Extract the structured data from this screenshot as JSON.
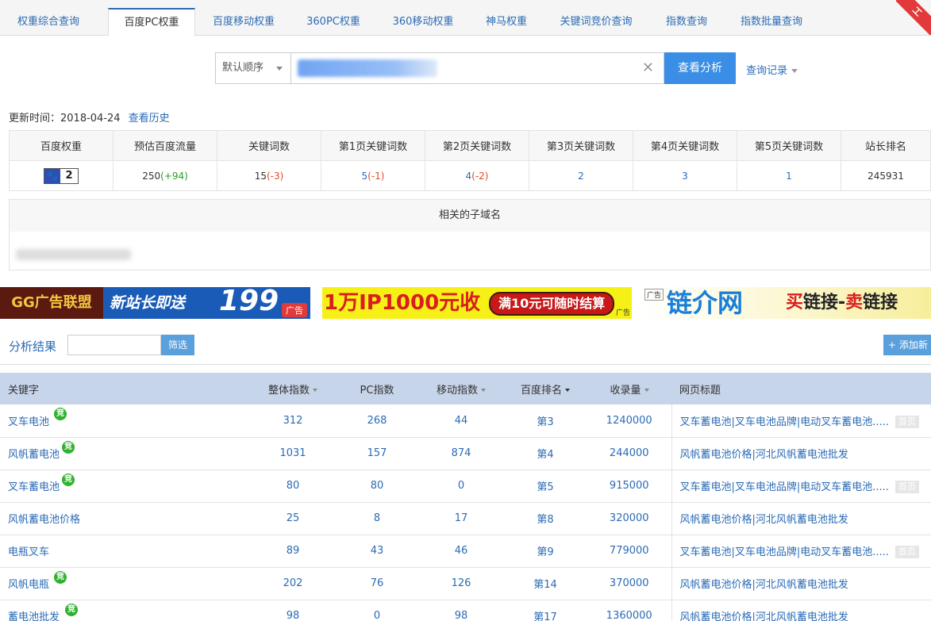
{
  "tabs": [
    {
      "label": "权重综合查询",
      "active": false
    },
    {
      "label": "百度PC权重",
      "active": true
    },
    {
      "label": "百度移动权重",
      "active": false
    },
    {
      "label": "360PC权重",
      "active": false
    },
    {
      "label": "360移动权重",
      "active": false
    },
    {
      "label": "神马权重",
      "active": false
    },
    {
      "label": "关键词竞价查询",
      "active": false
    },
    {
      "label": "指数查询",
      "active": false
    },
    {
      "label": "指数批量查询",
      "active": false
    }
  ],
  "search": {
    "order_label": "默认顺序",
    "clear_glyph": "✕",
    "analyze_label": "查看分析",
    "history_label": "查询记录"
  },
  "update": {
    "label": "更新时间：2018-04-24",
    "history_link": "查看历史"
  },
  "weight_table": {
    "headers": [
      "百度权重",
      "预估百度流量",
      "关键词数",
      "第1页关键词数",
      "第2页关键词数",
      "第3页关键词数",
      "第4页关键词数",
      "第5页关键词数",
      "站长排名"
    ],
    "weight_value": "2",
    "paw_glyph": "🐾",
    "traffic": "250",
    "traffic_delta": "(+94)",
    "keywords": "15",
    "keywords_delta": "(-3)",
    "page1": "5",
    "page1_delta": "(-1)",
    "page2": "4",
    "page2_delta": "(-2)",
    "page3": "2",
    "page4": "3",
    "page5": "1",
    "rank": "245931"
  },
  "subdomain": {
    "title": "相关的子域名"
  },
  "banners": {
    "b1_left": "GG广告联盟",
    "b1_mid": "新站长即送",
    "b1_num": "199",
    "b1_tag": "广告",
    "b2_big": "1万IP1000元收",
    "b2_pill": "满10元可随时结算",
    "b2_ad": "广告",
    "b3_ad": "广告",
    "b3_logo": "链介网",
    "b3_buy": "买",
    "b3_link1": "链接-",
    "b3_sell": "卖",
    "b3_link2": "链接"
  },
  "results": {
    "title": "分析结果",
    "filter_label": "筛选",
    "add_label": "+ 添加新",
    "columns": [
      "关键字",
      "整体指数",
      "PC指数",
      "移动指数",
      "百度排名",
      "收录量",
      "网页标题"
    ],
    "jing_glyph": "竞",
    "home_badge": "首页",
    "rows": [
      {
        "keyword": "叉车电池",
        "jing": true,
        "total": "312",
        "pc": "268",
        "mobile": "44",
        "rank": "第3",
        "indexed": "1240000",
        "title": "叉车蓄电池|叉车电池品牌|电动叉车蓄电池.....",
        "home": true
      },
      {
        "keyword": "风帆蓄电池",
        "jing": true,
        "total": "1031",
        "pc": "157",
        "mobile": "874",
        "rank": "第4",
        "indexed": "244000",
        "title": "风帆蓄电池价格|河北风帆蓄电池批发",
        "home": false
      },
      {
        "keyword": "叉车蓄电池",
        "jing": true,
        "total": "80",
        "pc": "80",
        "mobile": "0",
        "rank": "第5",
        "indexed": "915000",
        "title": "叉车蓄电池|叉车电池品牌|电动叉车蓄电池.....",
        "home": true
      },
      {
        "keyword": "风帆蓄电池价格",
        "jing": false,
        "total": "25",
        "pc": "8",
        "mobile": "17",
        "rank": "第8",
        "indexed": "320000",
        "title": "风帆蓄电池价格|河北风帆蓄电池批发",
        "home": false
      },
      {
        "keyword": "电瓶叉车",
        "jing": false,
        "total": "89",
        "pc": "43",
        "mobile": "46",
        "rank": "第9",
        "indexed": "779000",
        "title": "叉车蓄电池|叉车电池品牌|电动叉车蓄电池.....",
        "home": true
      },
      {
        "keyword": "风帆电瓶",
        "jing": true,
        "total": "202",
        "pc": "76",
        "mobile": "126",
        "rank": "第14",
        "indexed": "370000",
        "title": "风帆蓄电池价格|河北风帆蓄电池批发",
        "home": false
      },
      {
        "keyword": "蓄电池批发",
        "jing": true,
        "total": "98",
        "pc": "0",
        "mobile": "98",
        "rank": "第17",
        "indexed": "1360000",
        "title": "风帆蓄电池价格|河北风帆蓄电池批发",
        "home": false
      }
    ]
  }
}
